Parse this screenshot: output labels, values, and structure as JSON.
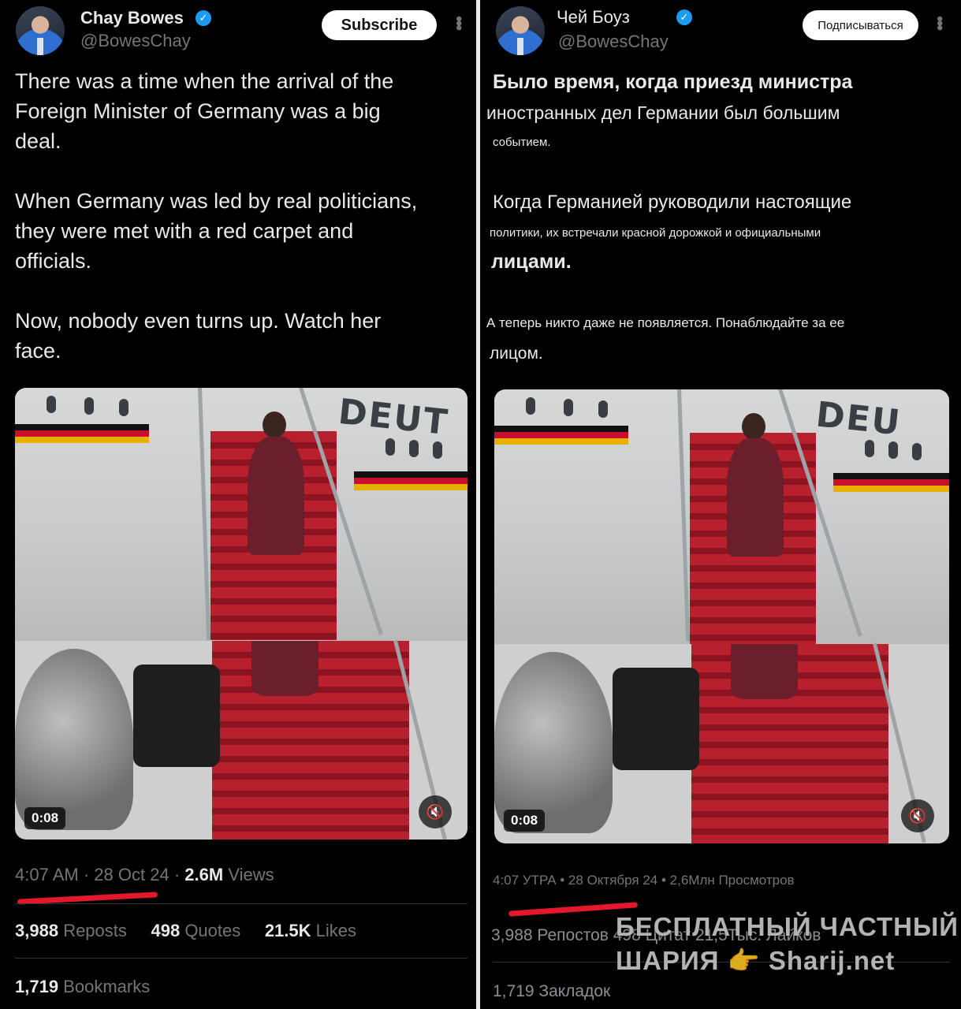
{
  "left": {
    "author_name": "Chay Bowes",
    "handle": "@BowesChay",
    "subscribe_label": "Subscribe",
    "tweet_paragraphs": [
      "There was a time when the arrival of the\nForeign Minister of Germany was a big\ndeal.",
      "When Germany was led by real politicians,\nthey were met with a red carpet and\nofficials.",
      "Now, nobody even turns up. Watch her\nface."
    ],
    "video": {
      "plane_text": "DEUT",
      "duration": "0:08"
    },
    "time": "4:07 AM",
    "date": "28 Oct 24",
    "views_count": "2.6M",
    "views_label": "Views",
    "reposts_count": "3,988",
    "reposts_label": "Reposts",
    "quotes_count": "498",
    "quotes_label": "Quotes",
    "likes_count": "21.5K",
    "likes_label": "Likes",
    "bookmarks_count": "1,719",
    "bookmarks_label": "Bookmarks"
  },
  "right": {
    "author_name": "Чей Боуз",
    "handle": "@BowesChay",
    "subscribe_label": "Подписываться",
    "tweet_lines": [
      "Было время, когда приезд министра",
      "иностранных дел Германии был большим",
      "событием.",
      "Когда Германией руководили настоящие",
      "политики, их встречали красной дорожкой и официальными",
      "лицами.",
      "А теперь никто даже не появляется. Понаблюдайте за ее",
      "лицом."
    ],
    "video": {
      "plane_text": "DEU",
      "duration": "0:08"
    },
    "meta_line": "4:07 УТРА • 28 Октября 24 • 2,6Млн Просмотров",
    "stats_line": "3,988 Репостов 498 Цитат 21,5Тыс. Лайков",
    "bookmarks_line": "1,719 Закладок"
  },
  "watermark": {
    "line1": "БЕСПЛАТНЫЙ  ЧАСТНЫЙ",
    "line2": "ШАРИЯ 👉 Sharij.net"
  },
  "colors": {
    "background": "#000000",
    "text": "#e7e9ea",
    "muted": "#71767b",
    "verified": "#1d9bf0",
    "annotation_red": "#e3182d"
  }
}
